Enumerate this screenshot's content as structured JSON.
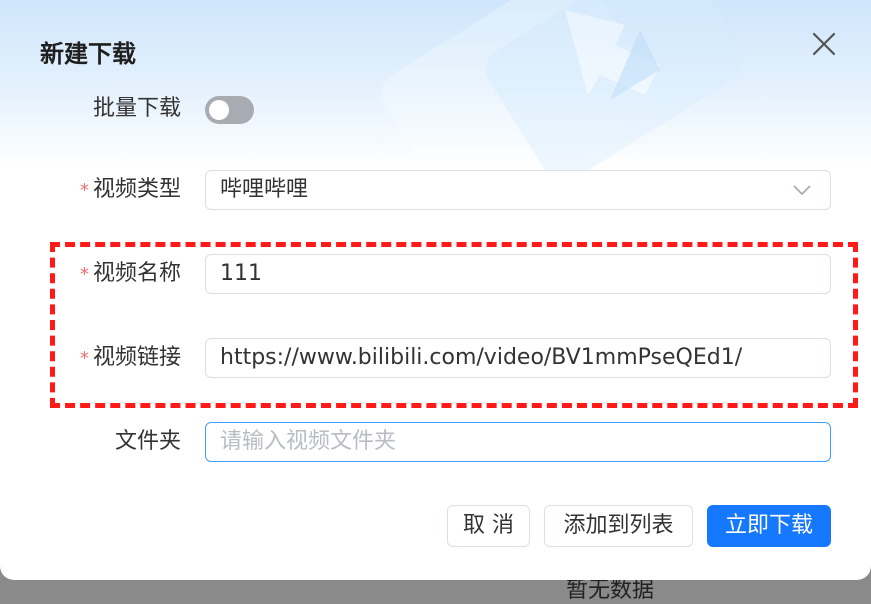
{
  "dialog": {
    "title": "新建下载"
  },
  "form": {
    "batch_label": "批量下载",
    "batch_enabled": false,
    "video_type": {
      "label": "视频类型",
      "required_mark": "*",
      "value": "哔哩哔哩"
    },
    "video_name": {
      "label": "视频名称",
      "required_mark": "*",
      "value": "111"
    },
    "video_link": {
      "label": "视频链接",
      "required_mark": "*",
      "value": "https://www.bilibili.com/video/BV1mmPseQEd1/"
    },
    "folder": {
      "label": "文件夹",
      "value": "",
      "placeholder": "请输入视频文件夹"
    }
  },
  "buttons": {
    "cancel": "取 消",
    "add_to_list": "添加到列表",
    "download_now": "立即下载"
  },
  "backdrop": {
    "partial_text": "暂无数据"
  },
  "colors": {
    "primary": "#1677ff",
    "required": "#f56c6c",
    "highlight": "#ff1a1a",
    "focus_border": "#409eff"
  },
  "icons": {
    "close": "close-icon",
    "dropdown": "chevron-down-icon"
  }
}
